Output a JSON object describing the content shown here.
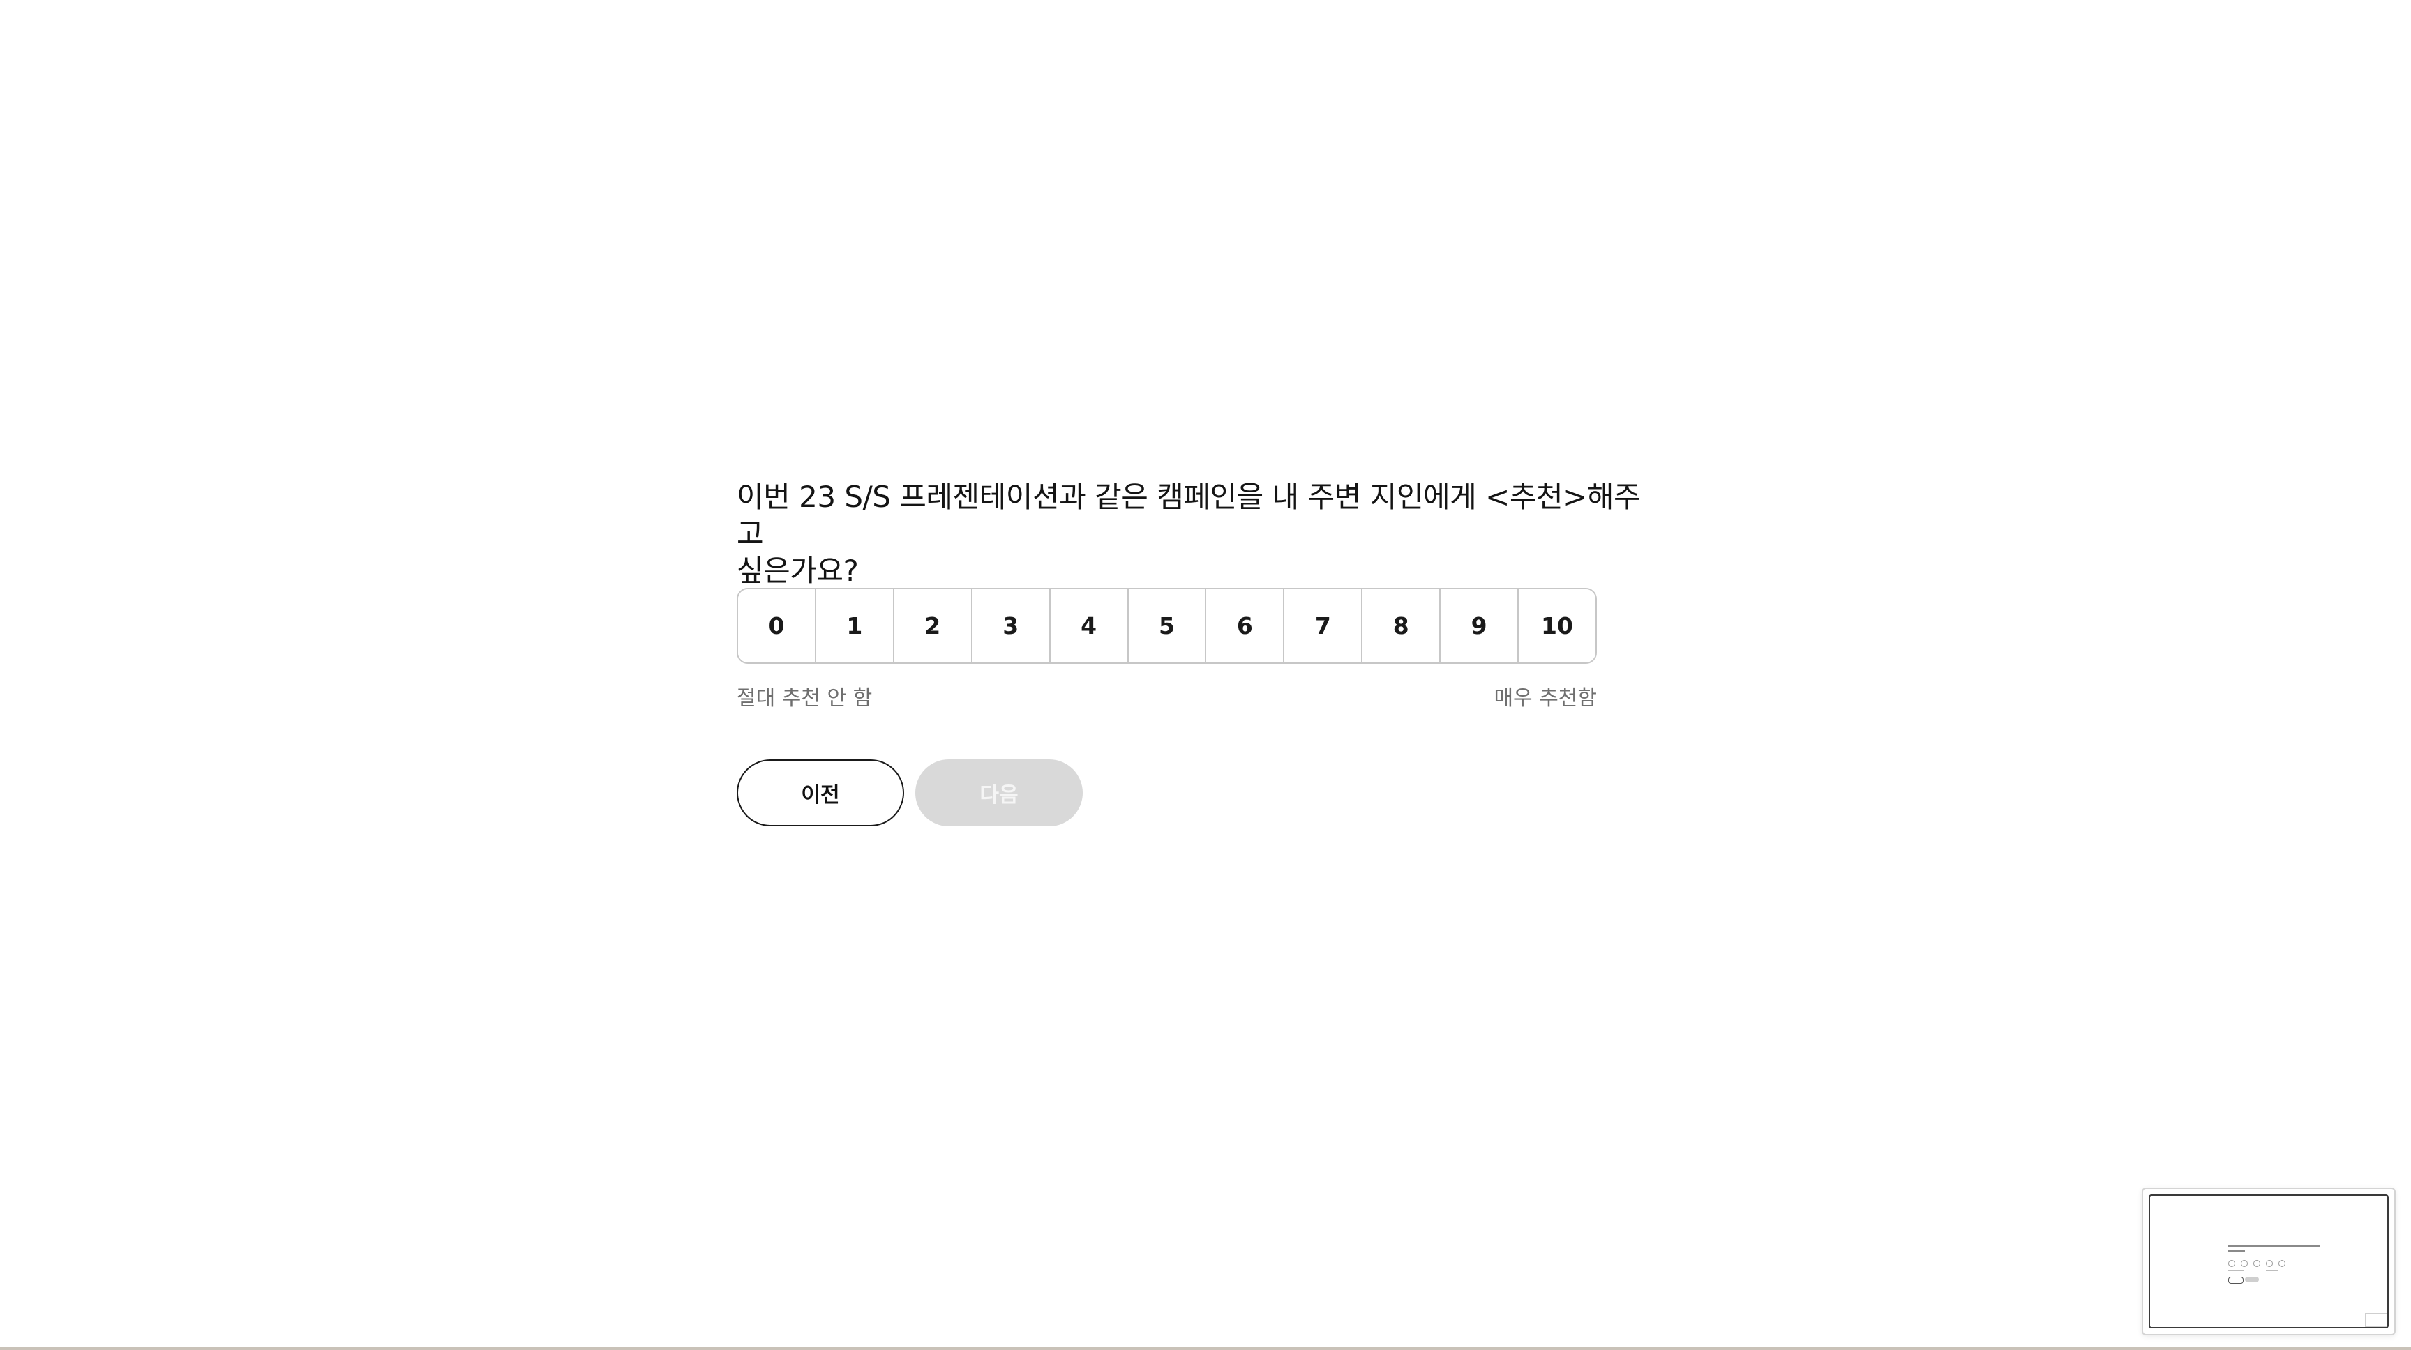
{
  "question": {
    "line1": "이번 23 S/S 프레젠테이션과 같은 캠페인을 내 주변 지인에게 <추천>해주고",
    "line2": "싶은가요?"
  },
  "scale": {
    "options": [
      "0",
      "1",
      "2",
      "3",
      "4",
      "5",
      "6",
      "7",
      "8",
      "9",
      "10"
    ],
    "min_label": "절대 추천 안 함",
    "max_label": "매우 추천함"
  },
  "buttons": {
    "prev_label": "이전",
    "next_label": "다음",
    "next_enabled": false
  },
  "colors": {
    "border": "#c7c7c7",
    "disabled_button": "#d9d9d9",
    "label_gray": "#6f6f6f",
    "text": "#141414"
  }
}
